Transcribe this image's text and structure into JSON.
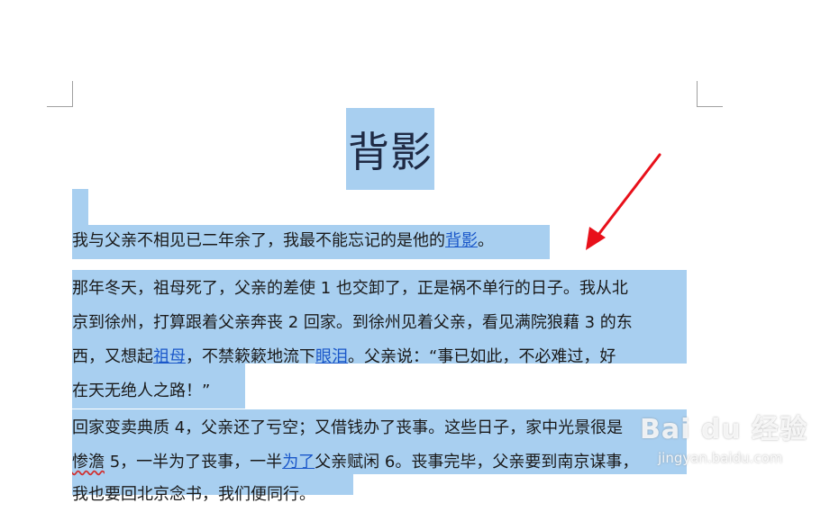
{
  "document": {
    "title": "背影",
    "paragraphs": [
      {
        "lines": [
          [
            {
              "t": "我与父亲不相见已二年余了，我最不能忘记的是他的"
            },
            {
              "t": "背影",
              "link": true
            },
            {
              "t": "。"
            }
          ]
        ]
      },
      {
        "lines": [
          [
            {
              "t": "那年冬天，祖母死了，父亲的差使 1 也交卸了，正是祸不单行的日子。我从北"
            }
          ],
          [
            {
              "t": "京到徐州，打算跟着父亲奔丧 2 回家。到徐州见着父亲，看见满院狼藉 3 的东"
            }
          ],
          [
            {
              "t": "西，又想起"
            },
            {
              "t": "祖母",
              "link": true
            },
            {
              "t": "，不禁簌簌地流下"
            },
            {
              "t": "眼泪",
              "link": true
            },
            {
              "t": "。父亲说：“事已如此，不必难过，好"
            }
          ],
          [
            {
              "t": "在天无绝人之路！”"
            }
          ]
        ]
      },
      {
        "lines": [
          [
            {
              "t": "回家变卖典质 4，父亲还了亏空；又借钱办了丧事。这些日子，家中光景很是"
            }
          ],
          [
            {
              "t": "惨澹",
              "squiggle": true
            },
            {
              "t": " 5，一半为了丧事，一半"
            },
            {
              "t": "为了",
              "link": true
            },
            {
              "t": "父亲赋闲 6。丧事完毕，父亲要到南京谋事，"
            }
          ],
          [
            {
              "t": "我也要回北京念书，我们便同行。"
            }
          ]
        ]
      }
    ]
  },
  "watermark": {
    "logo": "Bai du 经验",
    "url": "jingyan.baidu.com"
  },
  "colors": {
    "selection": "#a8cff0",
    "link": "#1a57c9",
    "arrow": "#e8101a"
  }
}
